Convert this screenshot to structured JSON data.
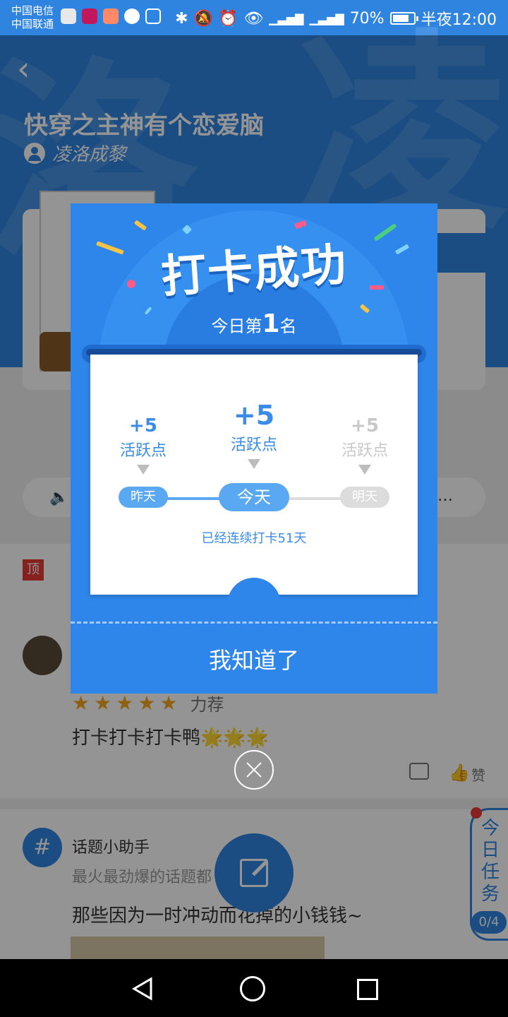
{
  "status_bar": {
    "carrier1": "中国电信",
    "carrier2": "中国联通",
    "battery": "70%",
    "battery_level": 0.7,
    "time": "半夜12:00"
  },
  "book": {
    "title": "快穿之主神有个恋爱脑",
    "author": "凌洛成黎"
  },
  "modal": {
    "title": "打卡成功",
    "rank_prefix": "今日第",
    "rank_number": "1",
    "rank_suffix": "名",
    "yesterday": {
      "points": "+5",
      "label": "活跃点",
      "day": "昨天"
    },
    "today": {
      "points": "+5",
      "label": "活跃点",
      "day": "今天"
    },
    "tomorrow": {
      "points": "+5",
      "label": "活跃点",
      "day": "明天"
    },
    "streak": "已经连续打卡51天",
    "confirm": "我知道了"
  },
  "post": {
    "top_badge": "顶",
    "rating_label": "力荐",
    "rating": 5,
    "review": "打卡打卡打卡鸭🌟🌟🌟",
    "like_label": "赞"
  },
  "topic": {
    "icon": "#",
    "name": "话题小助手",
    "desc": "最火最劲爆的话题都",
    "post": "那些因为一时冲动而花掉的小钱钱~"
  },
  "task": {
    "label": "今日任务",
    "count": "0/4"
  },
  "colors": {
    "primary": "#2f86ea",
    "active_blue": "#5aa8f2",
    "inactive": "#d8d8d8",
    "red": "#e53935"
  }
}
